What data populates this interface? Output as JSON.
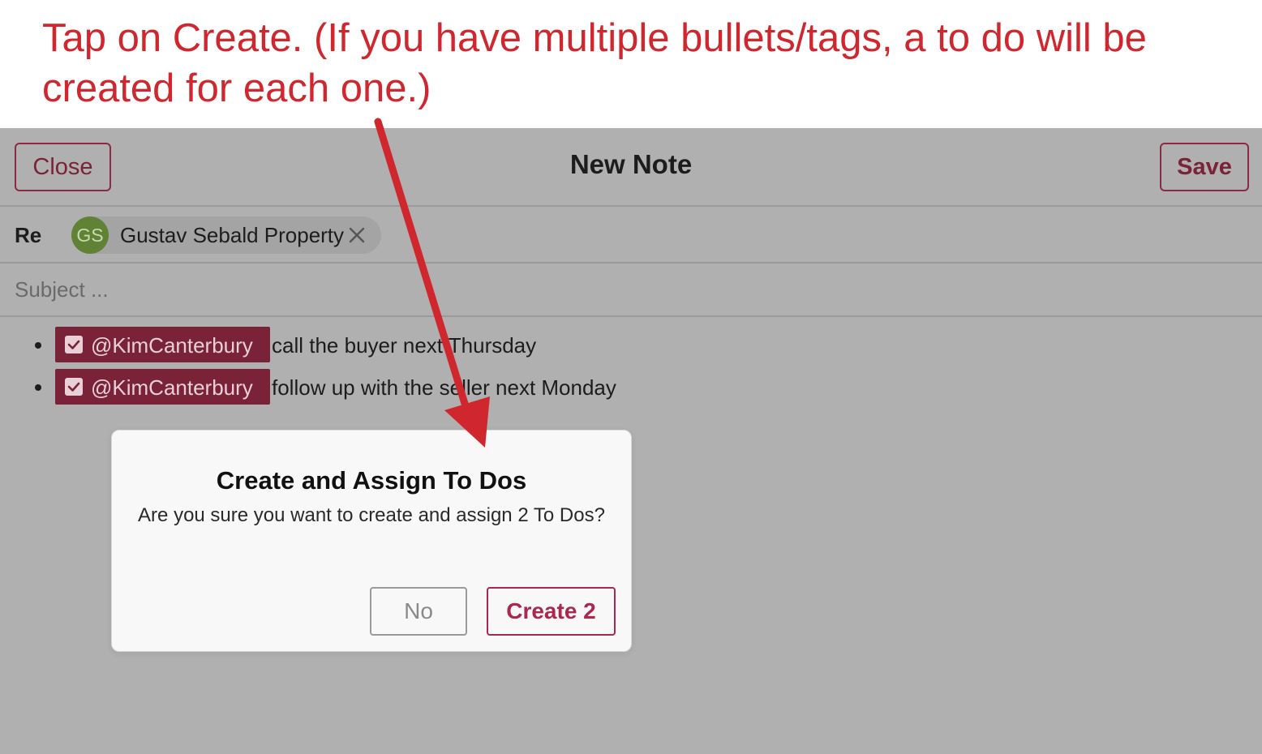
{
  "annotation": {
    "text": "Tap on Create. (If you have multiple bullets/tags, a to do will be created for each one.)",
    "color": "#d0272f"
  },
  "header": {
    "close_label": "Close",
    "title": "New Note",
    "save_label": "Save"
  },
  "regarding": {
    "label": "Re",
    "chip": {
      "initials": "GS",
      "name": "Gustav Sebald Property",
      "remove_icon": "close-icon",
      "avatar_color": "#5f8235"
    }
  },
  "subject": {
    "placeholder": "Subject ...",
    "value": ""
  },
  "bullets": [
    {
      "mention": "@KimCanterbury",
      "text": "call the buyer next Thursday",
      "icon": "checkbox-checked-icon"
    },
    {
      "mention": "@KimCanterbury",
      "text": "follow up with the seller next Monday",
      "icon": "checkbox-checked-icon"
    }
  ],
  "dialog": {
    "title": "Create and Assign To Dos",
    "message": "Are you sure you want to create and assign 2 To Dos?",
    "no_label": "No",
    "create_label": "Create 2"
  },
  "colors": {
    "accent": "#7a2238",
    "create_accent": "#a8284f",
    "overlay": "#b0b0b0",
    "annotation": "#d0272f"
  }
}
